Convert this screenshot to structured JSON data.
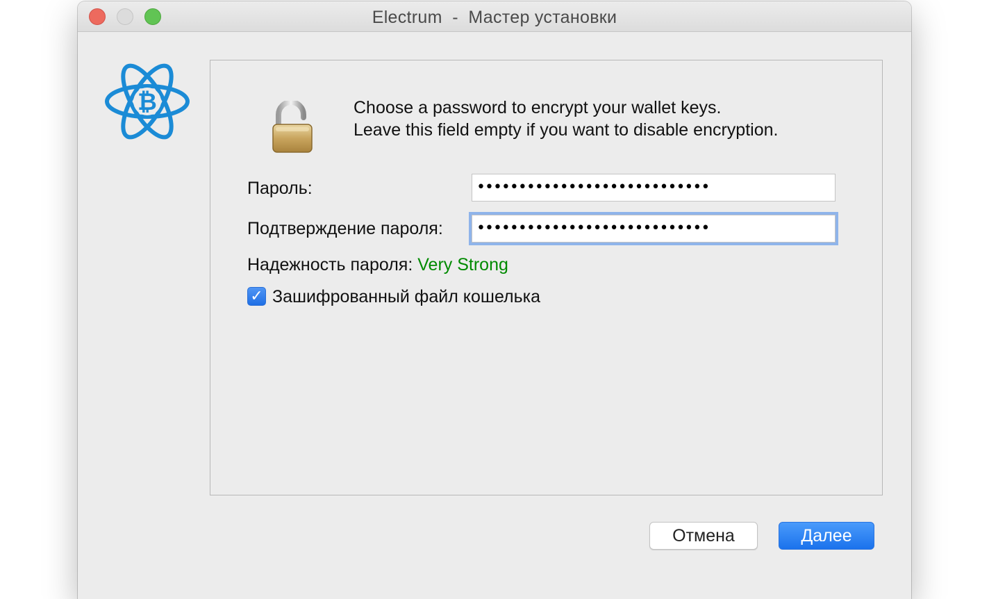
{
  "window": {
    "title": "Electrum  -  Мастер установки"
  },
  "icons": {
    "logo": "electrum-bitcoin-atom-logo",
    "lock": "unlocked-padlock-icon",
    "check": "checkmark-icon"
  },
  "message": {
    "line1": "Choose a password to encrypt your wallet keys.",
    "line2": "Leave this field empty if you want to disable encryption."
  },
  "form": {
    "password_label": "Пароль:",
    "password_value": "••••••••••••••••••••••••••••",
    "confirm_label": "Подтверждение пароля:",
    "confirm_value": "••••••••••••••••••••••••••••",
    "strength_label": "Надежность пароля:",
    "strength_value": "Very Strong",
    "encrypt_checkbox_label": "Зашифрованный файл кошелька",
    "encrypt_checked": true
  },
  "buttons": {
    "cancel": "Отмена",
    "next": "Далее"
  },
  "colors": {
    "strength": "#008a00",
    "accent": "#1f6fe5",
    "logo": "#1b8bd6"
  }
}
